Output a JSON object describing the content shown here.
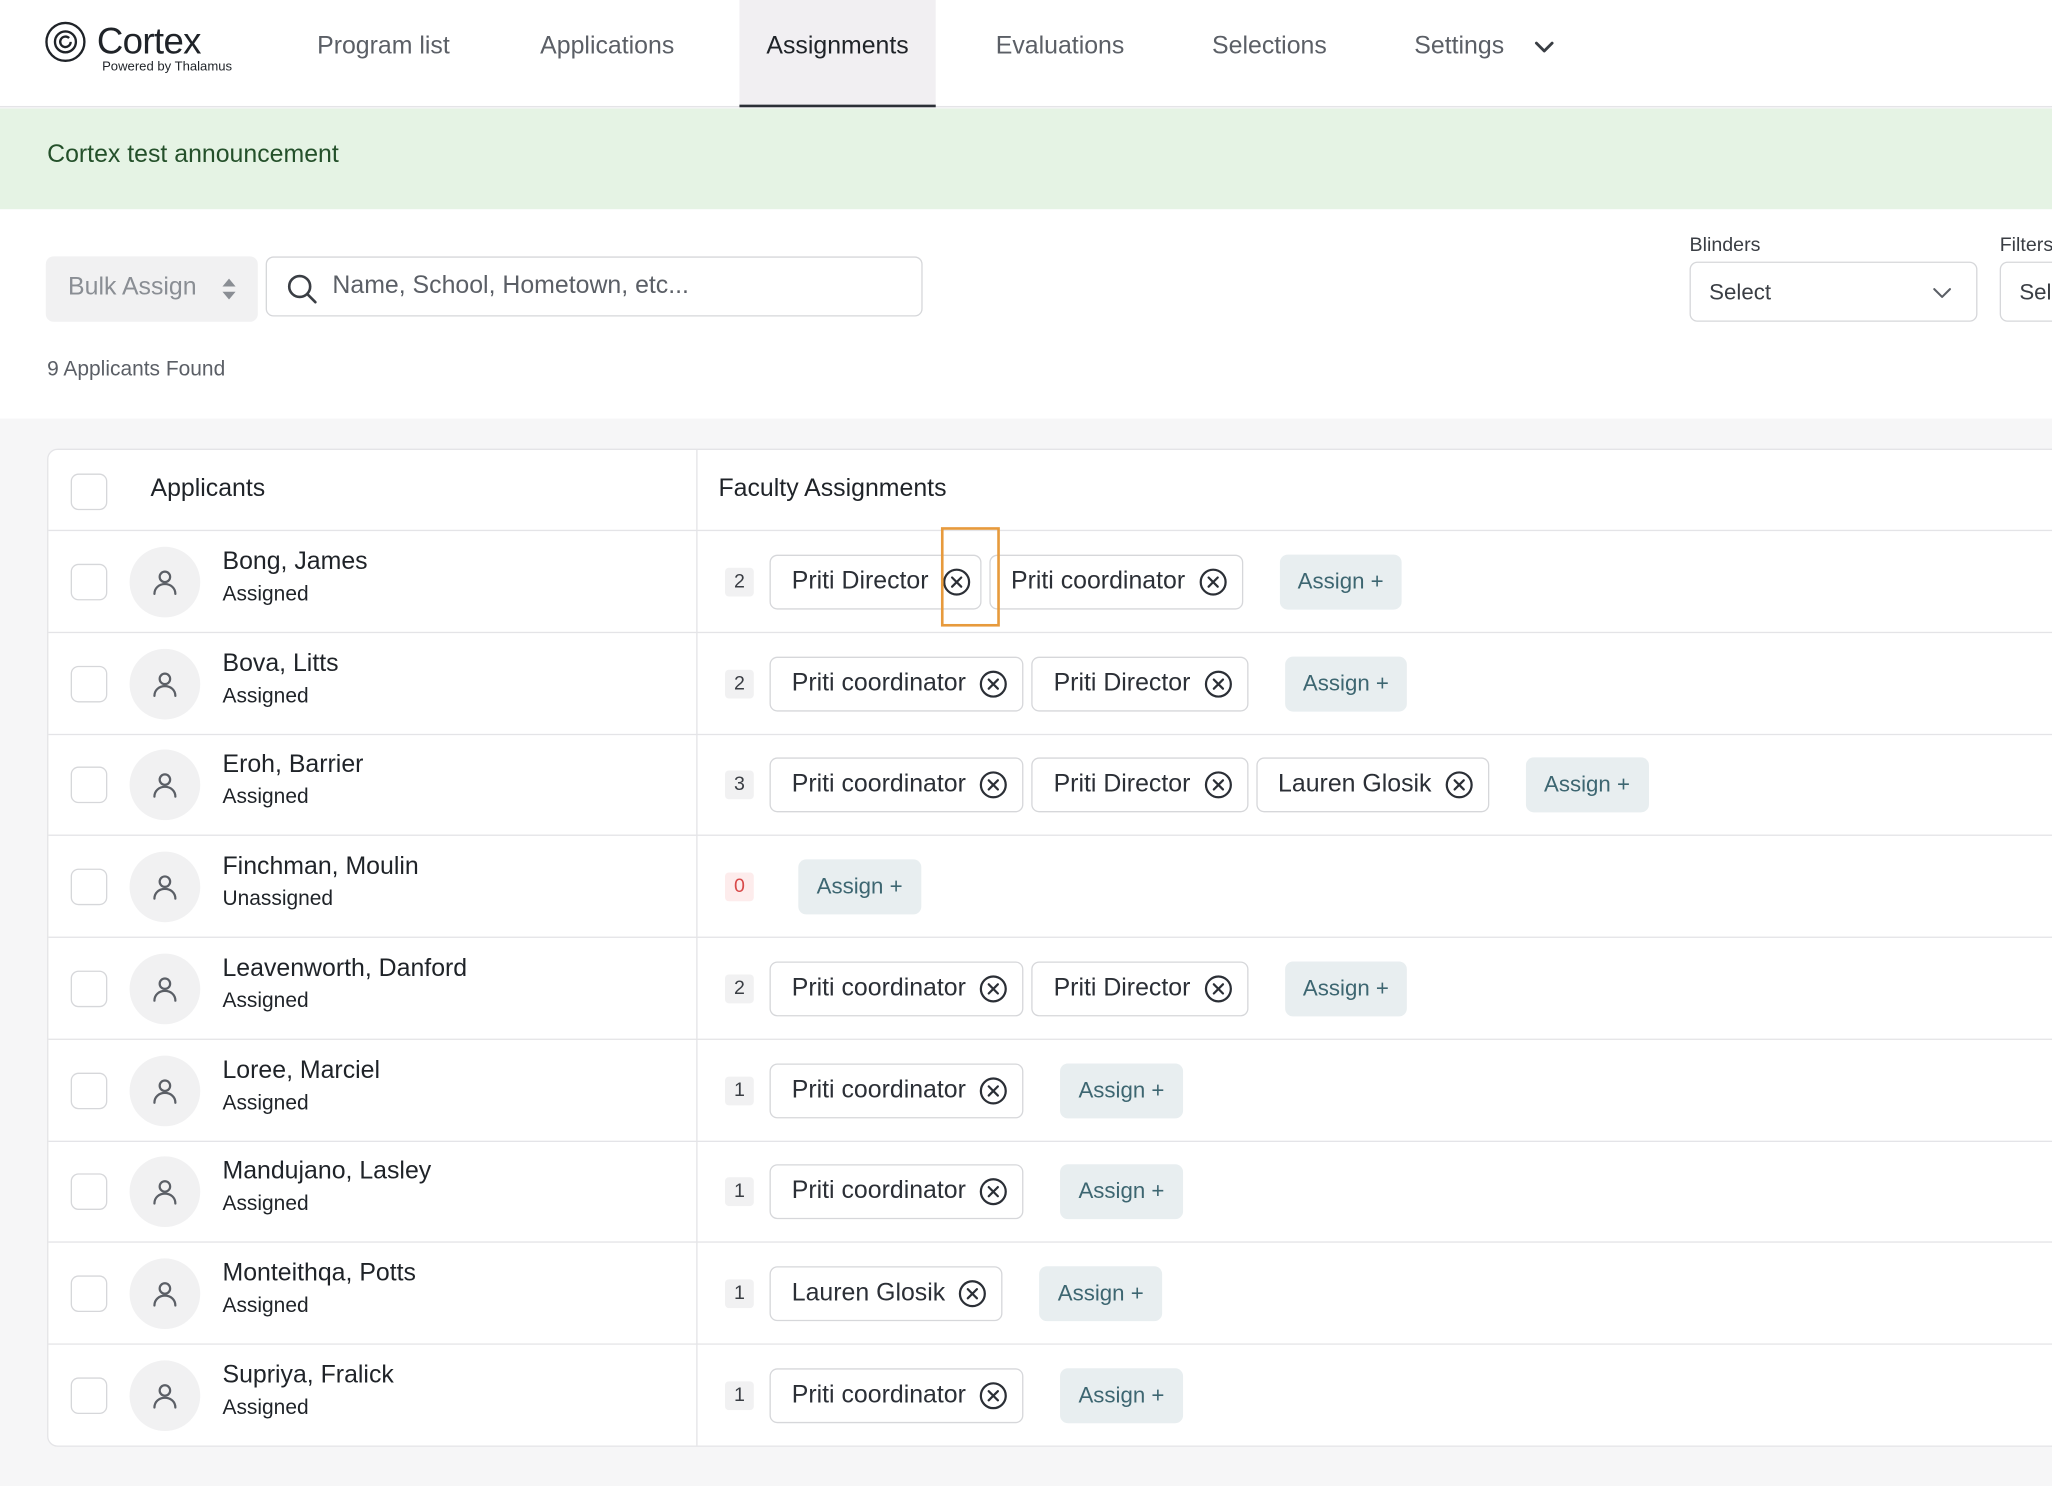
{
  "brand": {
    "name": "Cortex",
    "tagline": "Powered by Thalamus"
  },
  "nav": {
    "items": [
      {
        "label": "Program list",
        "active": false
      },
      {
        "label": "Applications",
        "active": false
      },
      {
        "label": "Assignments",
        "active": true
      },
      {
        "label": "Evaluations",
        "active": false
      },
      {
        "label": "Selections",
        "active": false
      },
      {
        "label": "Settings",
        "active": false
      }
    ]
  },
  "announcement": {
    "text": "Cortex test announcement"
  },
  "toolbar": {
    "bulk_assign_label": "Bulk Assign",
    "search_placeholder": "Name, School, Hometown, etc...",
    "search_value": "",
    "found_text": "9 Applicants Found",
    "blinders_label": "Blinders",
    "blinders_value": "Select",
    "filters_label": "Filters",
    "filters_value": "Select"
  },
  "table": {
    "col_applicants": "Applicants",
    "col_faculty": "Faculty Assignments",
    "assign_label": "Assign +",
    "rows": [
      {
        "name": "Bong, James",
        "status": "Assigned",
        "count": "2",
        "assignees": [
          "Priti Director",
          "Priti coordinator"
        ]
      },
      {
        "name": "Bova, Litts",
        "status": "Assigned",
        "count": "2",
        "assignees": [
          "Priti coordinator",
          "Priti Director"
        ]
      },
      {
        "name": "Eroh, Barrier",
        "status": "Assigned",
        "count": "3",
        "assignees": [
          "Priti coordinator",
          "Priti Director",
          "Lauren Glosik"
        ]
      },
      {
        "name": "Finchman, Moulin",
        "status": "Unassigned",
        "count": "0",
        "assignees": []
      },
      {
        "name": "Leavenworth, Danford",
        "status": "Assigned",
        "count": "2",
        "assignees": [
          "Priti coordinator",
          "Priti Director"
        ]
      },
      {
        "name": "Loree, Marciel",
        "status": "Assigned",
        "count": "1",
        "assignees": [
          "Priti coordinator"
        ]
      },
      {
        "name": "Mandujano, Lasley",
        "status": "Assigned",
        "count": "1",
        "assignees": [
          "Priti coordinator"
        ]
      },
      {
        "name": "Monteithqa, Potts",
        "status": "Assigned",
        "count": "1",
        "assignees": [
          "Lauren Glosik"
        ]
      },
      {
        "name": "Supriya, Fralick",
        "status": "Assigned",
        "count": "1",
        "assignees": [
          "Priti coordinator"
        ]
      }
    ]
  },
  "colors": {
    "announcement_bg": "#e5f3e4",
    "assign_button_bg": "#e8eef0",
    "zero_count": "#d84a4a",
    "focus_highlight": "#e79a3c"
  }
}
